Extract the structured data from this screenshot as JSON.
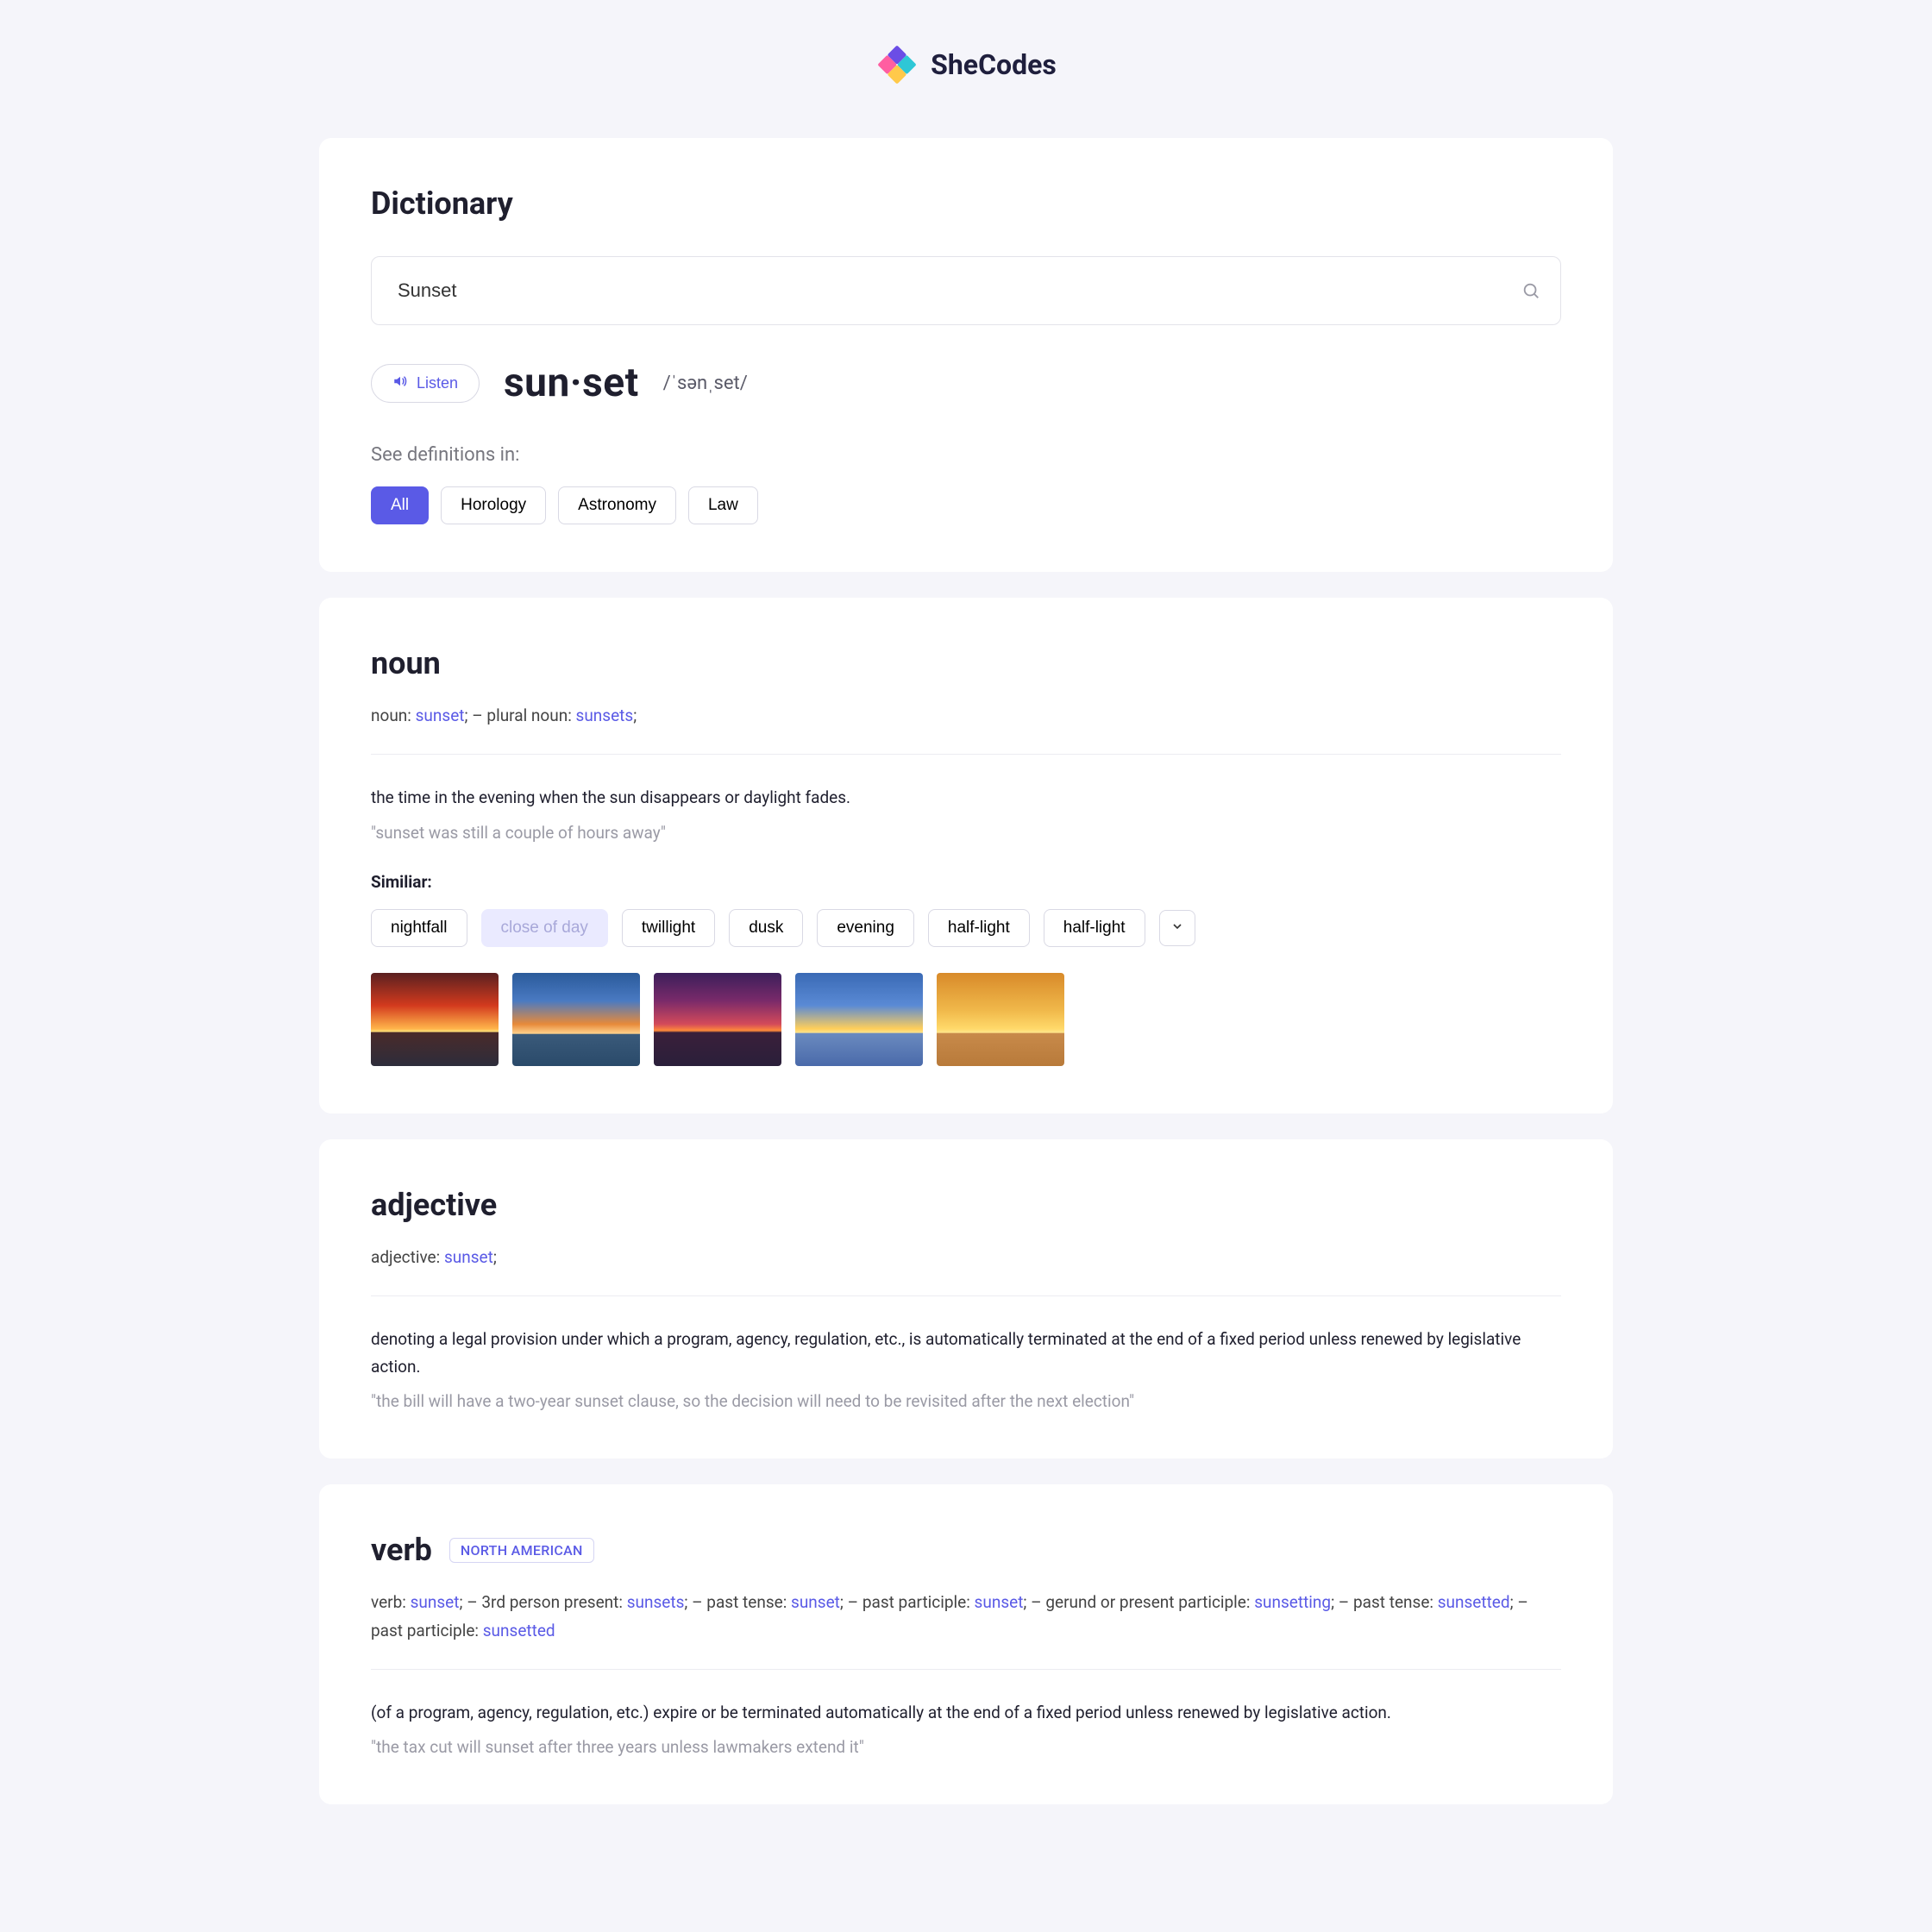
{
  "brand": {
    "name": "SheCodes"
  },
  "header": {
    "page_title": "Dictionary",
    "search_value": "Sunset"
  },
  "listen": {
    "button_label": "Listen",
    "word_display": "sun·set",
    "pronunciation": "/ˈsənˌset/"
  },
  "categories": {
    "label": "See definitions in:",
    "items": [
      "All",
      "Horology",
      "Astronomy",
      "Law"
    ],
    "active_index": 0
  },
  "entries": {
    "noun": {
      "pos_label": "noun",
      "forms_segments": [
        {
          "t": "plain",
          "v": "noun: "
        },
        {
          "t": "hl",
          "v": "sunset"
        },
        {
          "t": "plain",
          "v": ";   –   plural noun: "
        },
        {
          "t": "hl",
          "v": "sunsets"
        },
        {
          "t": "plain",
          "v": ";"
        }
      ],
      "definition": "the time in the evening when the sun disappears or daylight fades.",
      "example": "\"sunset was still a couple of hours away\"",
      "similar_label": "Similiar:",
      "similar": [
        {
          "label": "nightfall",
          "muted": false
        },
        {
          "label": "close of day",
          "muted": true
        },
        {
          "label": "twillight",
          "muted": false
        },
        {
          "label": "dusk",
          "muted": false
        },
        {
          "label": "evening",
          "muted": false
        },
        {
          "label": "half-light",
          "muted": false
        },
        {
          "label": "half-light",
          "muted": false
        }
      ]
    },
    "adjective": {
      "pos_label": "adjective",
      "forms_segments": [
        {
          "t": "plain",
          "v": "adjective: "
        },
        {
          "t": "hl",
          "v": "sunset"
        },
        {
          "t": "plain",
          "v": ";"
        }
      ],
      "definition": "denoting a legal provision under which a program, agency, regulation, etc., is automatically terminated at the end of a fixed period unless renewed by legislative action.",
      "example": "\"the bill will have a two-year sunset clause, so the decision will need to be revisited after the next election\""
    },
    "verb": {
      "pos_label": "verb",
      "region": "NORTH AMERICAN",
      "forms_segments": [
        {
          "t": "plain",
          "v": "verb: "
        },
        {
          "t": "hl",
          "v": "sunset"
        },
        {
          "t": "plain",
          "v": ";   –   3rd person present: "
        },
        {
          "t": "hl",
          "v": "sunsets"
        },
        {
          "t": "plain",
          "v": ";   –   past tense: "
        },
        {
          "t": "hl",
          "v": "sunset"
        },
        {
          "t": "plain",
          "v": ";   –   past participle: "
        },
        {
          "t": "hl",
          "v": "sunset"
        },
        {
          "t": "plain",
          "v": ";   –   gerund or present participle: "
        },
        {
          "t": "hl",
          "v": "sunsetting"
        },
        {
          "t": "plain",
          "v": ";   –   past tense: "
        },
        {
          "t": "hl",
          "v": "sunsetted"
        },
        {
          "t": "plain",
          "v": ";   –   past participle: "
        },
        {
          "t": "hl",
          "v": "sunsetted"
        }
      ],
      "definition": "(of a program, agency, regulation, etc.) expire or be terminated automatically at the end of a fixed period unless renewed by legislative action.",
      "example": "\"the tax cut will sunset after three years unless lawmakers extend it\""
    }
  }
}
